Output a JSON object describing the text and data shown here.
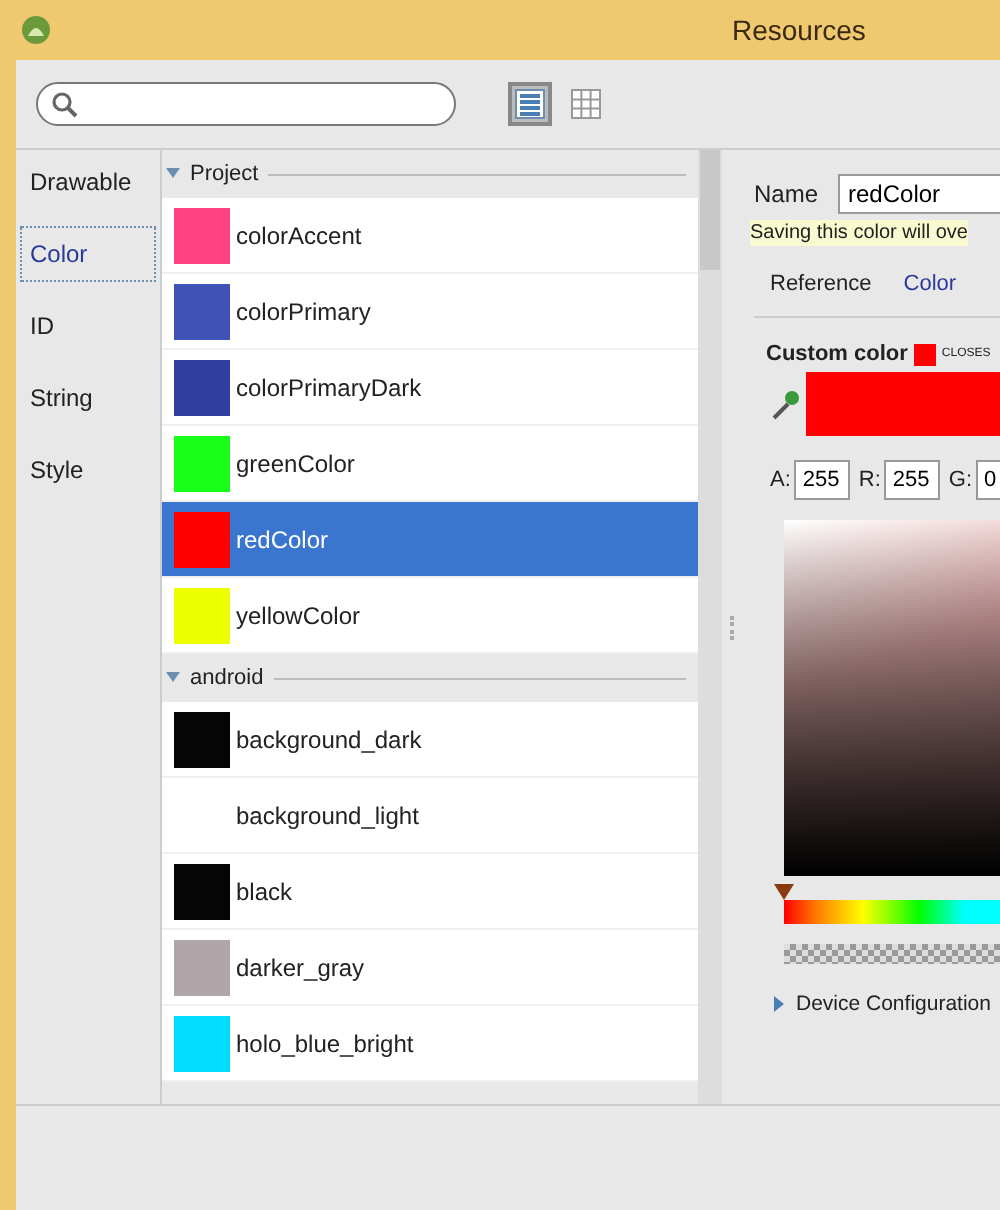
{
  "window": {
    "title": "Resources"
  },
  "search": {
    "focused": false
  },
  "view_modes": [
    {
      "kind": "list",
      "selected": true
    },
    {
      "kind": "grid",
      "selected": false
    }
  ],
  "categories": [
    {
      "label": "Drawable",
      "selected": false
    },
    {
      "label": "Color",
      "selected": true
    },
    {
      "label": "ID",
      "selected": false
    },
    {
      "label": "String",
      "selected": false
    },
    {
      "label": "Style",
      "selected": false
    }
  ],
  "groups": [
    {
      "title": "Project",
      "expanded": true,
      "items": [
        {
          "name": "colorAccent",
          "color": "#ff4081",
          "selected": false
        },
        {
          "name": "colorPrimary",
          "color": "#3f51b5",
          "selected": false
        },
        {
          "name": "colorPrimaryDark",
          "color": "#303f9f",
          "selected": false
        },
        {
          "name": "greenColor",
          "color": "#1aff1a",
          "selected": false
        },
        {
          "name": "redColor",
          "color": "#ff0000",
          "selected": true
        },
        {
          "name": "yellowColor",
          "color": "#eeff00",
          "selected": false
        }
      ]
    },
    {
      "title": "android",
      "expanded": true,
      "items": [
        {
          "name": "background_dark",
          "color": "#050505",
          "selected": false
        },
        {
          "name": "background_light",
          "selected": false
        },
        {
          "name": "black",
          "color": "#050505",
          "selected": false
        },
        {
          "name": "darker_gray",
          "color": "#b0a6aa",
          "selected": false
        },
        {
          "name": "holo_blue_bright",
          "color": "#00ddff",
          "selected": false
        }
      ]
    }
  ],
  "editor": {
    "name_label": "Name",
    "name_value": "redColor",
    "warning": "Saving this color will ove",
    "tabs": [
      {
        "label": "Reference",
        "selected": false
      },
      {
        "label": "Color",
        "selected": true
      }
    ],
    "custom_color_label": "Custom color",
    "closest_swatch": {
      "color": "#ff0000"
    },
    "preview": {
      "color": "#ff0000"
    },
    "closest_label": "CLOSES",
    "channels": [
      {
        "label": "A:",
        "value": "255"
      },
      {
        "label": "R:",
        "value": "255"
      },
      {
        "label": "G:",
        "value": "0"
      }
    ],
    "hue": {
      "level": 0
    },
    "device_configuration": {
      "label": "Device Configuration",
      "expanded": false
    }
  }
}
